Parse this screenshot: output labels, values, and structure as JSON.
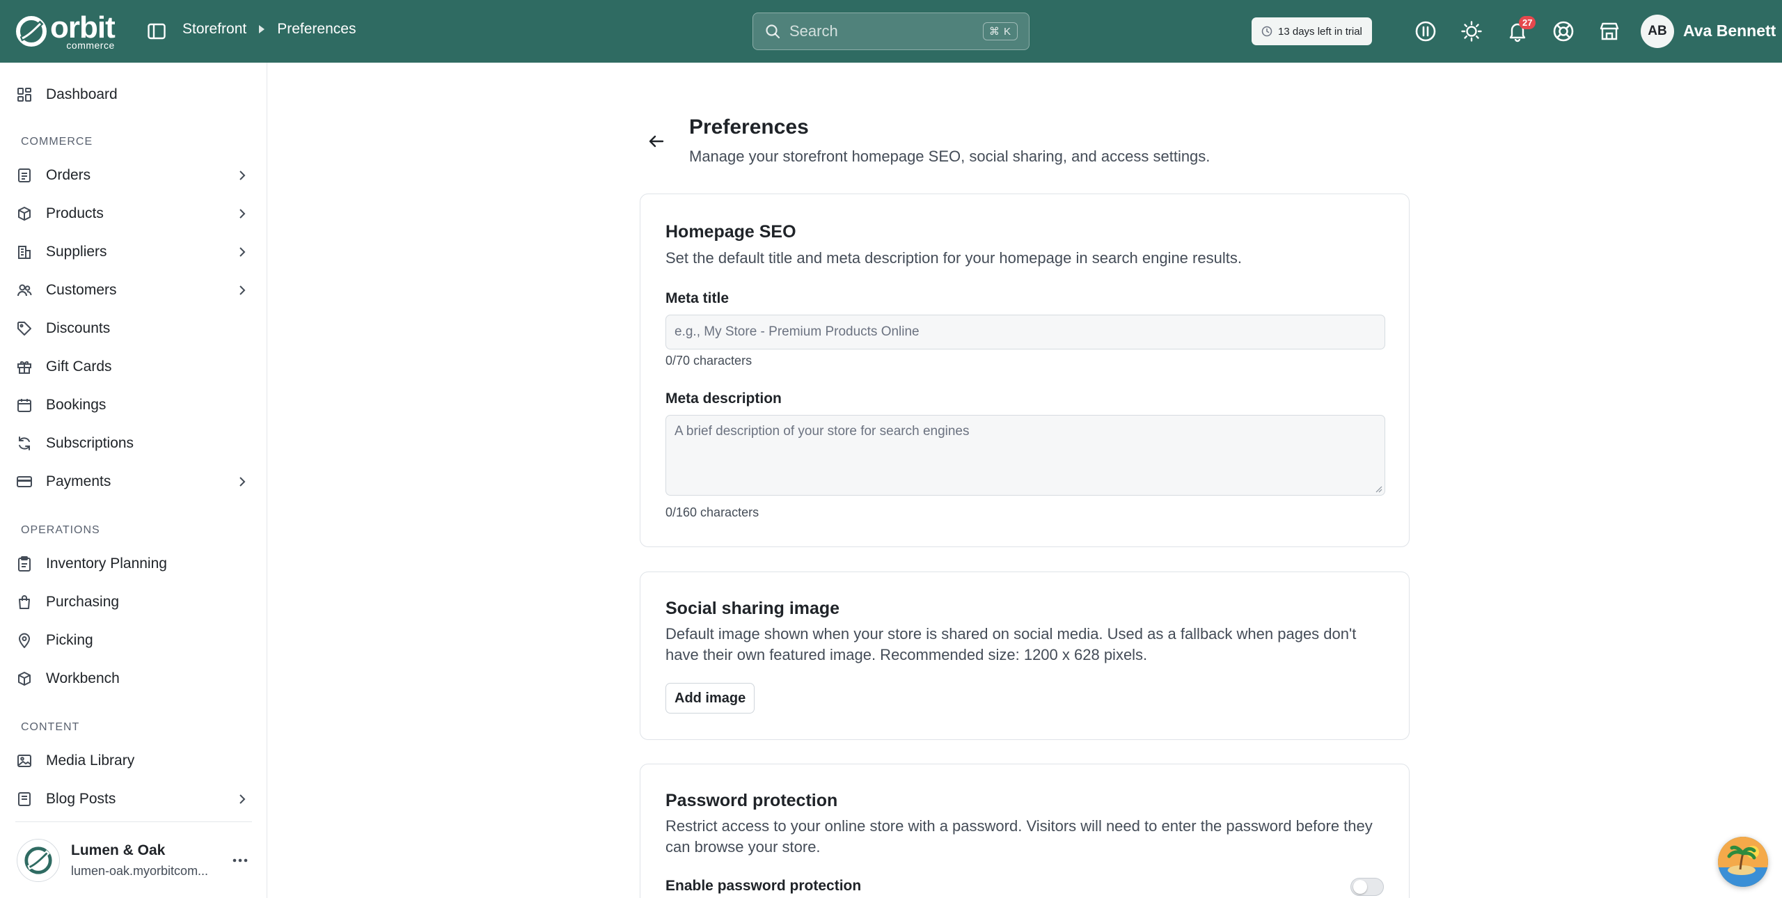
{
  "brand": {
    "name": "orbit",
    "sub": "commerce",
    "header_bg": "#2f6b62"
  },
  "breadcrumb": {
    "parent": "Storefront",
    "current": "Preferences"
  },
  "search": {
    "placeholder": "Search",
    "shortcut": "⌘ K"
  },
  "trial": {
    "text": "13 days left in trial"
  },
  "notifications": {
    "count": "27"
  },
  "user": {
    "initials": "AB",
    "name": "Ava Bennett"
  },
  "sidebar": {
    "top": [
      {
        "label": "Dashboard",
        "icon": "dashboard-icon"
      }
    ],
    "sections": [
      {
        "title": "COMMERCE",
        "items": [
          {
            "label": "Orders",
            "icon": "orders-icon",
            "expandable": true
          },
          {
            "label": "Products",
            "icon": "box-icon",
            "expandable": true
          },
          {
            "label": "Suppliers",
            "icon": "building-icon",
            "expandable": true
          },
          {
            "label": "Customers",
            "icon": "users-icon",
            "expandable": true
          },
          {
            "label": "Discounts",
            "icon": "tag-icon",
            "expandable": false
          },
          {
            "label": "Gift Cards",
            "icon": "gift-icon",
            "expandable": false
          },
          {
            "label": "Bookings",
            "icon": "calendar-icon",
            "expandable": false
          },
          {
            "label": "Subscriptions",
            "icon": "refresh-icon",
            "expandable": false
          },
          {
            "label": "Payments",
            "icon": "card-icon",
            "expandable": true
          }
        ]
      },
      {
        "title": "OPERATIONS",
        "items": [
          {
            "label": "Inventory Planning",
            "icon": "clipboard-icon",
            "expandable": false
          },
          {
            "label": "Purchasing",
            "icon": "bag-icon",
            "expandable": false
          },
          {
            "label": "Picking",
            "icon": "pin-icon",
            "expandable": false
          },
          {
            "label": "Workbench",
            "icon": "cube-icon",
            "expandable": false
          }
        ]
      },
      {
        "title": "CONTENT",
        "items": [
          {
            "label": "Media Library",
            "icon": "image-icon",
            "expandable": false
          },
          {
            "label": "Blog Posts",
            "icon": "post-icon",
            "expandable": true
          }
        ]
      }
    ],
    "store": {
      "name": "Lumen & Oak",
      "url": "lumen-oak.myorbitcom..."
    }
  },
  "page": {
    "title": "Preferences",
    "subtitle": "Manage your storefront homepage SEO, social sharing, and access settings."
  },
  "seo": {
    "title": "Homepage SEO",
    "description": "Set the default title and meta description for your homepage in search engine results.",
    "meta_title_label": "Meta title",
    "meta_title_value": "",
    "meta_title_placeholder": "e.g., My Store - Premium Products Online",
    "meta_title_count": "0/70 characters",
    "meta_desc_label": "Meta description",
    "meta_desc_value": "",
    "meta_desc_placeholder": "A brief description of your store for search engines",
    "meta_desc_count": "0/160 characters"
  },
  "social": {
    "title": "Social sharing image",
    "description": "Default image shown when your store is shared on social media. Used as a fallback when pages don't have their own featured image. Recommended size: 1200 x 628 pixels.",
    "add_button": "Add image"
  },
  "password": {
    "title": "Password protection",
    "description": "Restrict access to your online store with a password. Visitors will need to enter the password before they can browse your store.",
    "toggle_label": "Enable password protection",
    "enabled": false
  }
}
